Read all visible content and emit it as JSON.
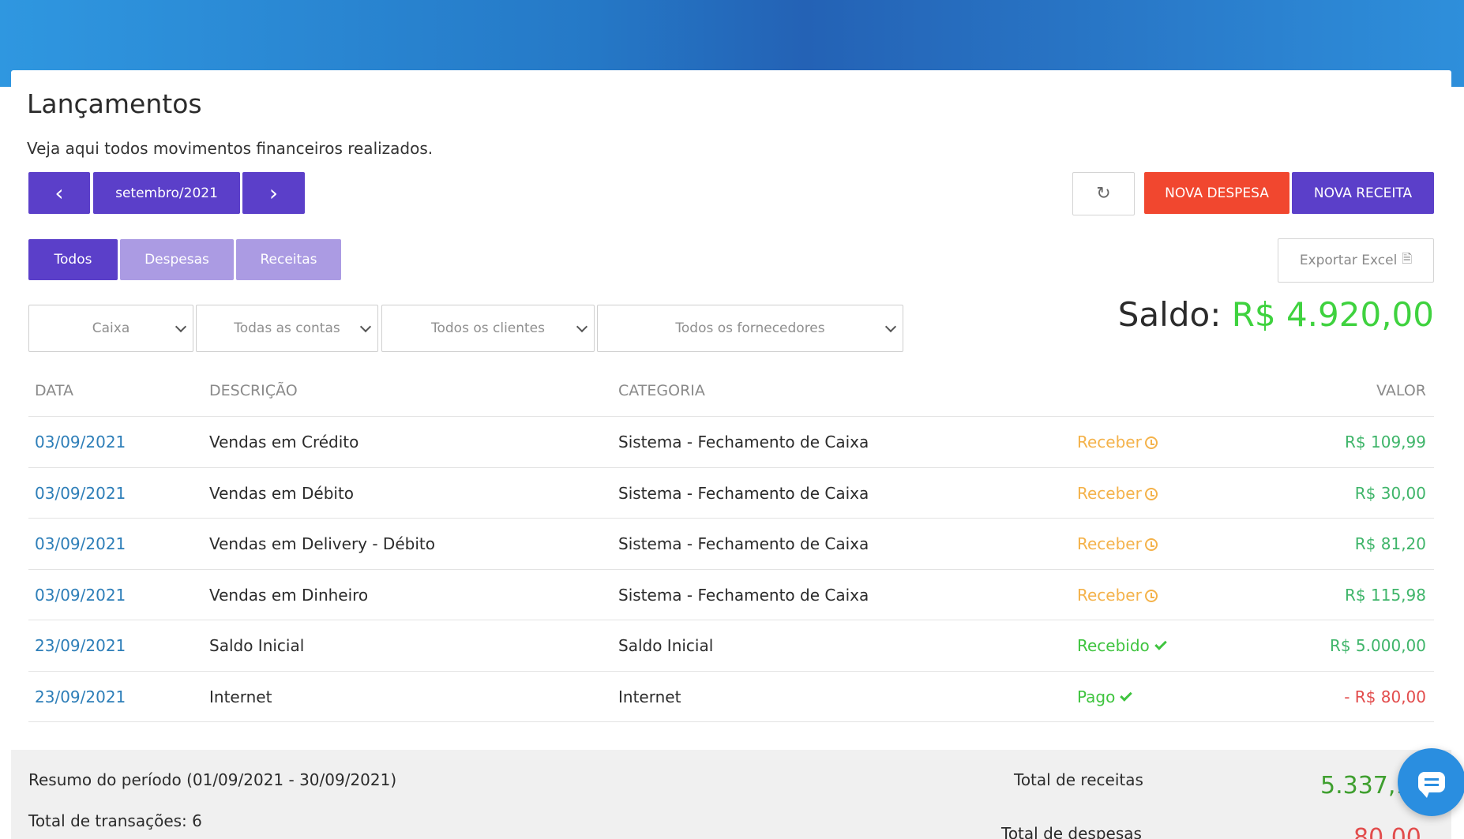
{
  "page": {
    "title": "Lançamentos",
    "subtitle": "Veja aqui todos movimentos financeiros realizados."
  },
  "month_nav": {
    "prev_icon": "‹",
    "current": "setembro/2021",
    "next_icon": "›"
  },
  "actions": {
    "refresh_icon": "↻",
    "nova_despesa": "NOVA DESPESA",
    "nova_receita": "NOVA RECEITA",
    "exportar_excel": "Exportar Excel",
    "excel_icon": "🗎"
  },
  "tabs": {
    "todos": "Todos",
    "despesas": "Despesas",
    "receitas": "Receitas",
    "active": "Todos"
  },
  "filters": {
    "caixa": "Caixa",
    "contas": "Todas as contas",
    "clientes": "Todos os clientes",
    "fornecedores": "Todos os fornecedores"
  },
  "saldo": {
    "label": "Saldo:",
    "value": "R$ 4.920,00"
  },
  "table": {
    "headers": {
      "data": "DATA",
      "descricao": "DESCRIÇÃO",
      "categoria": "CATEGORIA",
      "valor": "VALOR"
    },
    "rows": [
      {
        "data": "03/09/2021",
        "descricao": "Vendas em Crédito",
        "categoria": "Sistema - Fechamento de Caixa",
        "status": "Receber",
        "valor": "R$ 109,99"
      },
      {
        "data": "03/09/2021",
        "descricao": "Vendas em Débito",
        "categoria": "Sistema - Fechamento de Caixa",
        "status": "Receber",
        "valor": "R$ 30,00"
      },
      {
        "data": "03/09/2021",
        "descricao": "Vendas em Delivery - Débito",
        "categoria": "Sistema - Fechamento de Caixa",
        "status": "Receber",
        "valor": "R$ 81,20"
      },
      {
        "data": "03/09/2021",
        "descricao": "Vendas em Dinheiro",
        "categoria": "Sistema - Fechamento de Caixa",
        "status": "Receber",
        "valor": "R$ 115,98"
      },
      {
        "data": "23/09/2021",
        "descricao": "Saldo Inicial",
        "categoria": "Saldo Inicial",
        "status": "Recebido",
        "valor": "R$ 5.000,00"
      },
      {
        "data": "23/09/2021",
        "descricao": "Internet",
        "categoria": "Internet",
        "status": "Pago",
        "valor": "- R$ 80,00"
      }
    ]
  },
  "summary": {
    "periodo": "Resumo do período (01/09/2021 - 30/09/2021)",
    "transacoes": "Total de transações: 6",
    "total_receitas_label": "Total de receitas",
    "total_receitas_value": "5.337,1",
    "total_despesas_label": "Total de despesas",
    "total_despesas_value": "80,00"
  },
  "colors": {
    "primary": "#5b3fc9",
    "danger": "#f1472f",
    "saldo_green": "#3fd23f",
    "receber_orange": "#f4b24a",
    "chat_blue": "#2a8ee0"
  }
}
